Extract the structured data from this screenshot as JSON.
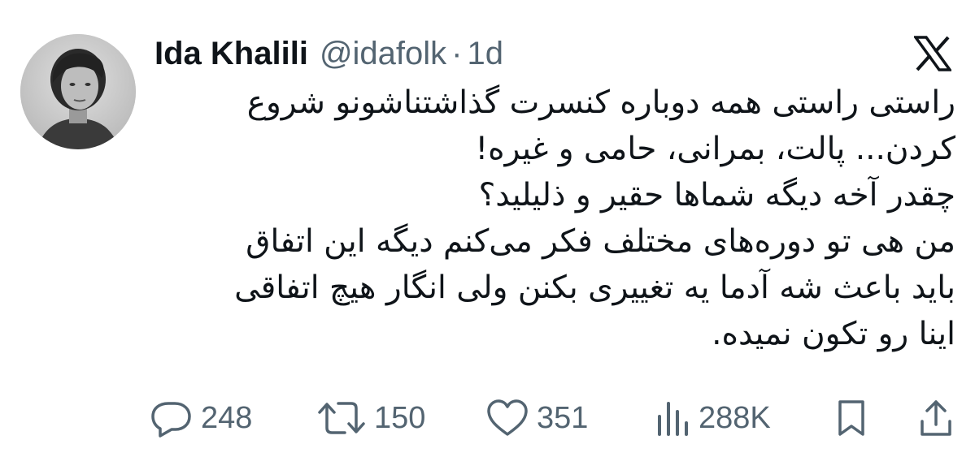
{
  "author": {
    "name": "Ida Khalili",
    "handle": "@idafolk",
    "separator": "·",
    "time": "1d"
  },
  "tweet": {
    "lines": [
      "راستی راستی همه دوباره کنسرت گذاشتناشونو شروع",
      "کردن... پالت، بمرانی، حامی و غیره!",
      "چقدر آخه دیگه شماها حقیر و ذلیلید؟",
      "من هی تو دوره‌های مختلف فکر می‌کنم دیگه این اتفاق",
      "باید باعث شه آدما یه تغییری بکنن ولی انگار هیچ اتفاقی",
      "اینا رو تکون نمیده."
    ]
  },
  "actions": {
    "replies": "248",
    "reposts": "150",
    "likes": "351",
    "views": "288K"
  },
  "icons": {
    "reply": "reply-icon",
    "repost": "repost-icon",
    "like": "heart-icon",
    "views": "views-icon",
    "bookmark": "bookmark-icon",
    "share": "share-icon",
    "platform": "x-logo-icon"
  },
  "colors": {
    "text": "#0f1419",
    "secondary": "#536471",
    "background": "#ffffff"
  }
}
